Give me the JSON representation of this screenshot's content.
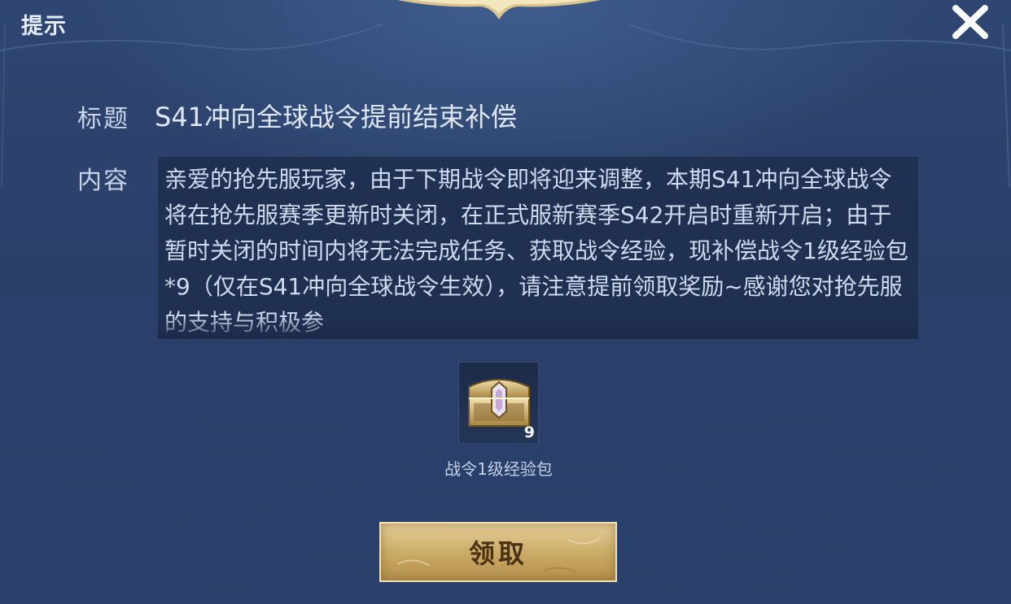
{
  "dialog": {
    "title": "提示",
    "close_icon": "close-icon"
  },
  "mail": {
    "title_label": "标题",
    "title_value": "S41冲向全球战令提前结束补偿",
    "content_label": "内容",
    "content_text": "亲爱的抢先服玩家，由于下期战令即将迎来调整，本期S41冲向全球战令将在抢先服赛季更新时关闭，在正式服新赛季S42开启时重新开启；由于暂时关闭的时间内将无法完成任务、获取战令经验，现补偿战令1级经验包*9（仅在S41冲向全球战令生效），请注意提前领取奖励~感谢您对抢先服的支持与积极参"
  },
  "reward": {
    "icon": "treasure-chest-icon",
    "count": "9",
    "name": "战令1级经验包"
  },
  "actions": {
    "claim_label": "领取"
  },
  "colors": {
    "background": "#2b416c",
    "button_gold": "#c9a964",
    "text": "#cfdaee"
  }
}
